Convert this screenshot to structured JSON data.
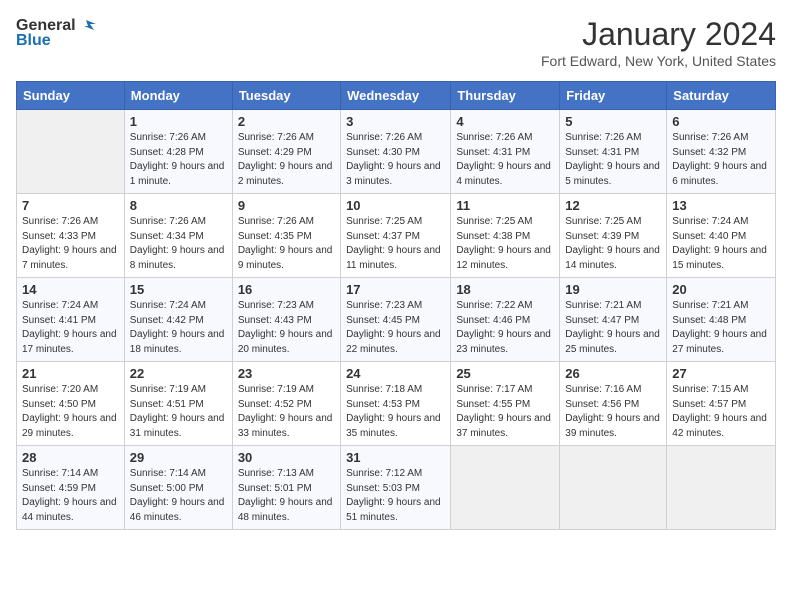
{
  "header": {
    "logo_line1": "General",
    "logo_line2": "Blue",
    "month_year": "January 2024",
    "location": "Fort Edward, New York, United States"
  },
  "days_of_week": [
    "Sunday",
    "Monday",
    "Tuesday",
    "Wednesday",
    "Thursday",
    "Friday",
    "Saturday"
  ],
  "weeks": [
    [
      {
        "day": "",
        "sunrise": "",
        "sunset": "",
        "daylight": ""
      },
      {
        "day": "1",
        "sunrise": "Sunrise: 7:26 AM",
        "sunset": "Sunset: 4:28 PM",
        "daylight": "Daylight: 9 hours and 1 minute."
      },
      {
        "day": "2",
        "sunrise": "Sunrise: 7:26 AM",
        "sunset": "Sunset: 4:29 PM",
        "daylight": "Daylight: 9 hours and 2 minutes."
      },
      {
        "day": "3",
        "sunrise": "Sunrise: 7:26 AM",
        "sunset": "Sunset: 4:30 PM",
        "daylight": "Daylight: 9 hours and 3 minutes."
      },
      {
        "day": "4",
        "sunrise": "Sunrise: 7:26 AM",
        "sunset": "Sunset: 4:31 PM",
        "daylight": "Daylight: 9 hours and 4 minutes."
      },
      {
        "day": "5",
        "sunrise": "Sunrise: 7:26 AM",
        "sunset": "Sunset: 4:31 PM",
        "daylight": "Daylight: 9 hours and 5 minutes."
      },
      {
        "day": "6",
        "sunrise": "Sunrise: 7:26 AM",
        "sunset": "Sunset: 4:32 PM",
        "daylight": "Daylight: 9 hours and 6 minutes."
      }
    ],
    [
      {
        "day": "7",
        "sunrise": "Sunrise: 7:26 AM",
        "sunset": "Sunset: 4:33 PM",
        "daylight": "Daylight: 9 hours and 7 minutes."
      },
      {
        "day": "8",
        "sunrise": "Sunrise: 7:26 AM",
        "sunset": "Sunset: 4:34 PM",
        "daylight": "Daylight: 9 hours and 8 minutes."
      },
      {
        "day": "9",
        "sunrise": "Sunrise: 7:26 AM",
        "sunset": "Sunset: 4:35 PM",
        "daylight": "Daylight: 9 hours and 9 minutes."
      },
      {
        "day": "10",
        "sunrise": "Sunrise: 7:25 AM",
        "sunset": "Sunset: 4:37 PM",
        "daylight": "Daylight: 9 hours and 11 minutes."
      },
      {
        "day": "11",
        "sunrise": "Sunrise: 7:25 AM",
        "sunset": "Sunset: 4:38 PM",
        "daylight": "Daylight: 9 hours and 12 minutes."
      },
      {
        "day": "12",
        "sunrise": "Sunrise: 7:25 AM",
        "sunset": "Sunset: 4:39 PM",
        "daylight": "Daylight: 9 hours and 14 minutes."
      },
      {
        "day": "13",
        "sunrise": "Sunrise: 7:24 AM",
        "sunset": "Sunset: 4:40 PM",
        "daylight": "Daylight: 9 hours and 15 minutes."
      }
    ],
    [
      {
        "day": "14",
        "sunrise": "Sunrise: 7:24 AM",
        "sunset": "Sunset: 4:41 PM",
        "daylight": "Daylight: 9 hours and 17 minutes."
      },
      {
        "day": "15",
        "sunrise": "Sunrise: 7:24 AM",
        "sunset": "Sunset: 4:42 PM",
        "daylight": "Daylight: 9 hours and 18 minutes."
      },
      {
        "day": "16",
        "sunrise": "Sunrise: 7:23 AM",
        "sunset": "Sunset: 4:43 PM",
        "daylight": "Daylight: 9 hours and 20 minutes."
      },
      {
        "day": "17",
        "sunrise": "Sunrise: 7:23 AM",
        "sunset": "Sunset: 4:45 PM",
        "daylight": "Daylight: 9 hours and 22 minutes."
      },
      {
        "day": "18",
        "sunrise": "Sunrise: 7:22 AM",
        "sunset": "Sunset: 4:46 PM",
        "daylight": "Daylight: 9 hours and 23 minutes."
      },
      {
        "day": "19",
        "sunrise": "Sunrise: 7:21 AM",
        "sunset": "Sunset: 4:47 PM",
        "daylight": "Daylight: 9 hours and 25 minutes."
      },
      {
        "day": "20",
        "sunrise": "Sunrise: 7:21 AM",
        "sunset": "Sunset: 4:48 PM",
        "daylight": "Daylight: 9 hours and 27 minutes."
      }
    ],
    [
      {
        "day": "21",
        "sunrise": "Sunrise: 7:20 AM",
        "sunset": "Sunset: 4:50 PM",
        "daylight": "Daylight: 9 hours and 29 minutes."
      },
      {
        "day": "22",
        "sunrise": "Sunrise: 7:19 AM",
        "sunset": "Sunset: 4:51 PM",
        "daylight": "Daylight: 9 hours and 31 minutes."
      },
      {
        "day": "23",
        "sunrise": "Sunrise: 7:19 AM",
        "sunset": "Sunset: 4:52 PM",
        "daylight": "Daylight: 9 hours and 33 minutes."
      },
      {
        "day": "24",
        "sunrise": "Sunrise: 7:18 AM",
        "sunset": "Sunset: 4:53 PM",
        "daylight": "Daylight: 9 hours and 35 minutes."
      },
      {
        "day": "25",
        "sunrise": "Sunrise: 7:17 AM",
        "sunset": "Sunset: 4:55 PM",
        "daylight": "Daylight: 9 hours and 37 minutes."
      },
      {
        "day": "26",
        "sunrise": "Sunrise: 7:16 AM",
        "sunset": "Sunset: 4:56 PM",
        "daylight": "Daylight: 9 hours and 39 minutes."
      },
      {
        "day": "27",
        "sunrise": "Sunrise: 7:15 AM",
        "sunset": "Sunset: 4:57 PM",
        "daylight": "Daylight: 9 hours and 42 minutes."
      }
    ],
    [
      {
        "day": "28",
        "sunrise": "Sunrise: 7:14 AM",
        "sunset": "Sunset: 4:59 PM",
        "daylight": "Daylight: 9 hours and 44 minutes."
      },
      {
        "day": "29",
        "sunrise": "Sunrise: 7:14 AM",
        "sunset": "Sunset: 5:00 PM",
        "daylight": "Daylight: 9 hours and 46 minutes."
      },
      {
        "day": "30",
        "sunrise": "Sunrise: 7:13 AM",
        "sunset": "Sunset: 5:01 PM",
        "daylight": "Daylight: 9 hours and 48 minutes."
      },
      {
        "day": "31",
        "sunrise": "Sunrise: 7:12 AM",
        "sunset": "Sunset: 5:03 PM",
        "daylight": "Daylight: 9 hours and 51 minutes."
      },
      {
        "day": "",
        "sunrise": "",
        "sunset": "",
        "daylight": ""
      },
      {
        "day": "",
        "sunrise": "",
        "sunset": "",
        "daylight": ""
      },
      {
        "day": "",
        "sunrise": "",
        "sunset": "",
        "daylight": ""
      }
    ]
  ]
}
